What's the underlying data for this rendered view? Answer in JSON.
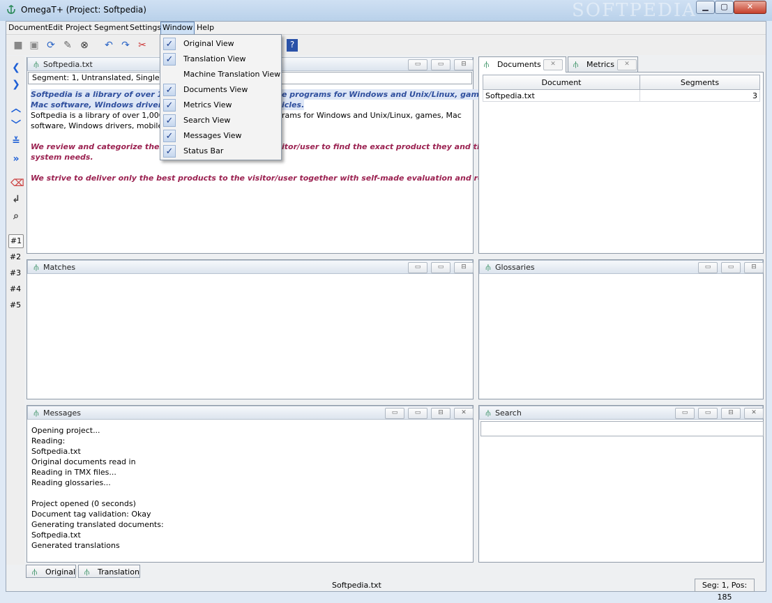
{
  "window": {
    "title": "OmegaT+ (Project: Softpedia)",
    "watermark": "SOFTPEDIA",
    "min": "▁",
    "max": "▢",
    "close": "✕"
  },
  "menubar": [
    "Document",
    "Edit",
    "Project",
    "Segment",
    "Settings",
    "Window",
    "Help"
  ],
  "window_menu": [
    {
      "label": "Original View",
      "checked": true
    },
    {
      "label": "Translation View",
      "checked": true
    },
    {
      "label": "Machine Translation View",
      "checked": false
    },
    {
      "label": "Documents View",
      "checked": true
    },
    {
      "label": "Metrics View",
      "checked": true
    },
    {
      "label": "Search View",
      "checked": true
    },
    {
      "label": "Messages View",
      "checked": true
    },
    {
      "label": "Status Bar",
      "checked": true
    }
  ],
  "check_glyph": "✓",
  "editor": {
    "title": "Softpedia.txt",
    "segment_info": "Segment: 1, Untranslated, Single",
    "line1a": "Softpedia is a library of over 1,000",
    "line1b": "e programs for Windows and Unix/Linux, games,",
    "line2a": "Mac software, Windows drivers, m",
    "line2b": "icles.",
    "line3a": "Softpedia is a library of over 1,000,000",
    "line3b": "rams for Windows and Unix/Linux, games, Mac",
    "line4a": "software, Windows drivers, mobile de",
    "line5a": "We review and categorize these pr",
    "line5b": "itor/user to find the exact product they and their",
    "line6": "system needs.",
    "line7": "We strive to deliver only the best products to the visitor/user together with self-made evaluation and review notes."
  },
  "panes": {
    "matches": "Matches",
    "glossaries": "Glossaries",
    "messages": "Messages",
    "search": "Search"
  },
  "tabs_right": [
    {
      "label": "Documents"
    },
    {
      "label": "Metrics"
    }
  ],
  "documents_table": {
    "headers": [
      "Document",
      "Segments"
    ],
    "rows": [
      [
        "Softpedia.txt",
        "3"
      ]
    ]
  },
  "messages_lines": [
    "Opening project...",
    "Reading:",
    "Softpedia.txt",
    "Original documents read in",
    "Reading in TMX files...",
    "Reading glossaries...",
    "",
    "Project opened (0 seconds)",
    "Document tag validation: Okay",
    "Generating translated documents:",
    "Softpedia.txt",
    "Generated translations"
  ],
  "nav_numbers": [
    "#1",
    "#2",
    "#3",
    "#4",
    "#5"
  ],
  "bottom_tabs": [
    "Original",
    "Translation"
  ],
  "status": {
    "file": "Softpedia.txt",
    "position": "Seg: 1, Pos: 185"
  }
}
